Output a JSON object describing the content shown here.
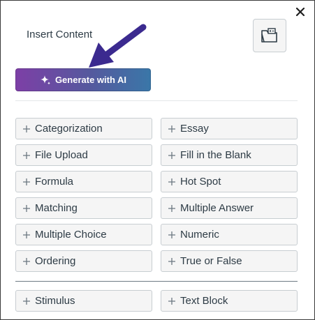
{
  "dialog": {
    "title": "Insert Content",
    "generate_button_label": "Generate with AI",
    "content_items": [
      {
        "label": "Categorization"
      },
      {
        "label": "Essay"
      },
      {
        "label": "File Upload"
      },
      {
        "label": "Fill in the Blank"
      },
      {
        "label": "Formula"
      },
      {
        "label": "Hot Spot"
      },
      {
        "label": "Matching"
      },
      {
        "label": "Multiple Answer"
      },
      {
        "label": "Multiple Choice"
      },
      {
        "label": "Numeric"
      },
      {
        "label": "Ordering"
      },
      {
        "label": "True or False"
      }
    ],
    "other_items": [
      {
        "label": "Stimulus"
      },
      {
        "label": "Text Block"
      }
    ]
  },
  "icons": {
    "close": "close-icon",
    "folder": "folder-icon",
    "sparkle": "sparkle-icon",
    "plus": "plus-icon",
    "annotation_arrow": "arrow-icon"
  },
  "colors": {
    "ai_gradient_start": "#7d3fa6",
    "ai_gradient_end": "#3a77a8",
    "arrow": "#3b2a8f",
    "text": "#2d3b45"
  }
}
